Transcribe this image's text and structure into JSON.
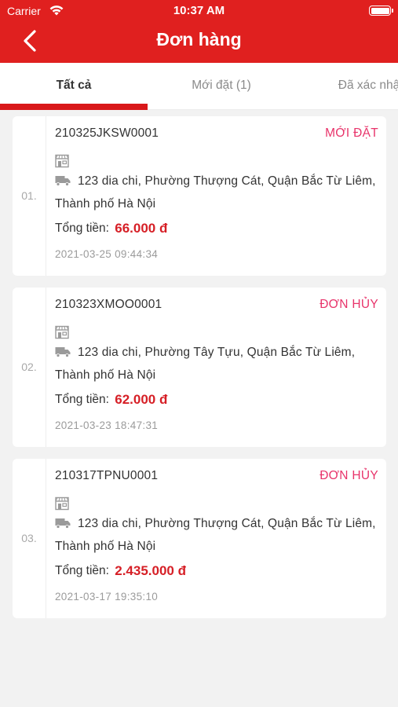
{
  "status_bar": {
    "carrier": "Carrier",
    "time": "10:37 AM"
  },
  "header": {
    "title": "Đơn hàng",
    "back_icon": "chevron-left-icon"
  },
  "tabs": [
    {
      "label": "Tất cả",
      "active": true
    },
    {
      "label": "Mới đặt (1)",
      "active": false
    },
    {
      "label": "Đã xác nhậ",
      "active": false
    }
  ],
  "orders": [
    {
      "index": "01.",
      "code": "210325JKSW0001",
      "status": "MỚI ĐẶT",
      "address": "123 dia chi, Phường Thượng Cát, Quận Bắc Từ Liêm, Thành phố Hà Nội",
      "total_label": "Tổng tiền:",
      "total_value": "66.000 đ",
      "date": "2021-03-25 09:44:34"
    },
    {
      "index": "02.",
      "code": "210323XMOO0001",
      "status": "ĐƠN HỦY",
      "address": "123 dia chi, Phường Tây Tựu, Quận Bắc Từ Liêm, Thành phố Hà Nội",
      "total_label": "Tổng tiền:",
      "total_value": "62.000 đ",
      "date": "2021-03-23 18:47:31"
    },
    {
      "index": "03.",
      "code": "210317TPNU0001",
      "status": "ĐƠN HỦY",
      "address": "123 dia chi, Phường Thượng Cát, Quận Bắc Từ Liêm, Thành phố Hà Nội",
      "total_label": "Tổng tiền:",
      "total_value": "2.435.000 đ",
      "date": "2021-03-17 19:35:10"
    }
  ],
  "colors": {
    "brand": "#e0201f",
    "status": "#e8336a",
    "price": "#d61f26"
  }
}
